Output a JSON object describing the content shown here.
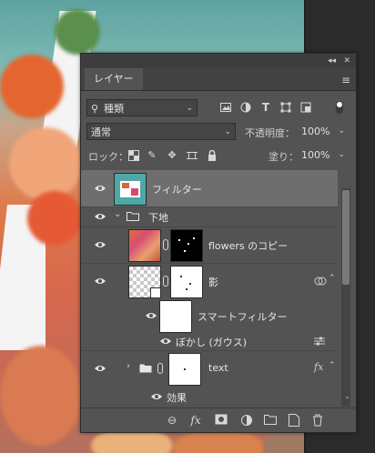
{
  "panel": {
    "tab_label": "レイヤー",
    "collapse_glyph": "◂◂",
    "close_glyph": "✕",
    "menu_glyph": "≡"
  },
  "filter": {
    "kind_label": "種類"
  },
  "blend": {
    "mode": "通常",
    "opacity_label": "不透明度：",
    "opacity_value": "100%"
  },
  "lock": {
    "label": "ロック：",
    "fill_label": "塗り：",
    "fill_value": "100%"
  },
  "layers": [
    {
      "name": "フィルター",
      "type": "image",
      "selected": true
    },
    {
      "name": "下地",
      "type": "group"
    },
    {
      "name": "flowers のコピー",
      "type": "image-with-mask"
    },
    {
      "name": "影",
      "type": "smart-object"
    },
    {
      "name": "スマートフィルター",
      "type": "smart-filter"
    },
    {
      "name": "ぼかし (ガウス)",
      "type": "filter-effect"
    },
    {
      "name": "text",
      "type": "text-group"
    },
    {
      "name": "効果",
      "type": "effects"
    }
  ],
  "colors": {
    "panel_bg": "#535353",
    "selected_bg": "#6e6e6e",
    "titlebar_bg": "#3d3d3d"
  }
}
